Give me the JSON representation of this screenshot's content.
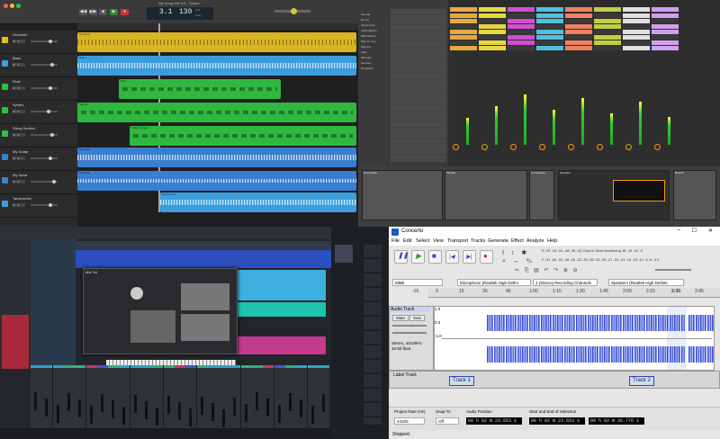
{
  "logic": {
    "window_title": "My Song Mix 3.0 - Tracks",
    "lcd_bar": "3.1",
    "lcd_tempo": "130",
    "lcd_key": "4/4",
    "lcd_keysig": "Cmaj",
    "tracks": [
      {
        "name": "Drummer",
        "color": "#e0c020"
      },
      {
        "name": "Bass",
        "color": "#3aa0e0"
      },
      {
        "name": "Flute",
        "color": "#2ec040"
      },
      {
        "name": "Synths",
        "color": "#2ec040"
      },
      {
        "name": "String Section",
        "color": "#2ec040"
      },
      {
        "name": "My Guitar",
        "color": "#3a80d0"
      },
      {
        "name": "My Vocal",
        "color": "#3a80d0"
      },
      {
        "name": "Tambourine",
        "color": "#3aa0e0"
      }
    ],
    "regions": [
      {
        "label": "Drummer"
      },
      {
        "label": "Bass"
      },
      {
        "label": "Flute"
      },
      {
        "label": "Synths"
      },
      {
        "label": "String Section"
      },
      {
        "label": "My Guitar"
      },
      {
        "label": "My Vocal"
      },
      {
        "label": "Tambourine"
      }
    ]
  },
  "ableton": {
    "browser_items": [
      "Sounds",
      "Drums",
      "Instruments",
      "Audio Effects",
      "MIDI Effects",
      "Max for Live",
      "Plug-ins",
      "Clips",
      "Samples",
      "Grooves",
      "Templates"
    ],
    "channel_colors": [
      "#e8a840",
      "#e8d840",
      "#d050d0",
      "#50c0e0",
      "#f08060",
      "#c0d040",
      "#e0e0e0",
      "#d0a0f0"
    ],
    "devices": [
      "Drum Rack",
      "Simpler",
      "Compressor",
      "Operator",
      "Reverb"
    ]
  },
  "studio_one": {
    "synth_title": "Mai Tai"
  },
  "audacity": {
    "window_title": "Concerto",
    "menu": [
      "File",
      "Edit",
      "Select",
      "View",
      "Transport",
      "Tracks",
      "Generate",
      "Effect",
      "Analyze",
      "Help"
    ],
    "meter_hint": "Click to Start Monitoring",
    "host": "MME",
    "input_device": "Microphone (Realtek High Defini",
    "channels": "2 (Stereo) Recording Channels",
    "output_device": "Speakers (Realtek High Definiti",
    "ruler_ticks": [
      "-15",
      "0",
      "15",
      "30",
      "45",
      "1:00",
      "1:15",
      "1:30",
      "1:45",
      "2:00",
      "2:15",
      "2:30",
      "2:45"
    ],
    "audio_track": {
      "name": "Audio Track",
      "mute": "Mute",
      "solo": "Solo",
      "info": "Stereo, 44100Hz",
      "bits": "32-bit float",
      "scale_top": "1.0",
      "scale_mid": "0.0",
      "scale_bot": "-1.0"
    },
    "label_track_name": "Label Track",
    "labels": [
      "Track 1",
      "Track 2"
    ],
    "selection_bar": {
      "rate_label": "Project Rate (Hz)",
      "rate_value": "44100",
      "snap_label": "Snap-To",
      "snap_value": "Off",
      "pos_label": "Audio Position",
      "pos_value": "00 h 02 m 23.653 s",
      "sel_label": "Start and End of Selection",
      "sel_start": "00 h 02 m 23.653 s",
      "sel_end": "00 h 02 m 36.776 s"
    },
    "status": "Stopped."
  }
}
